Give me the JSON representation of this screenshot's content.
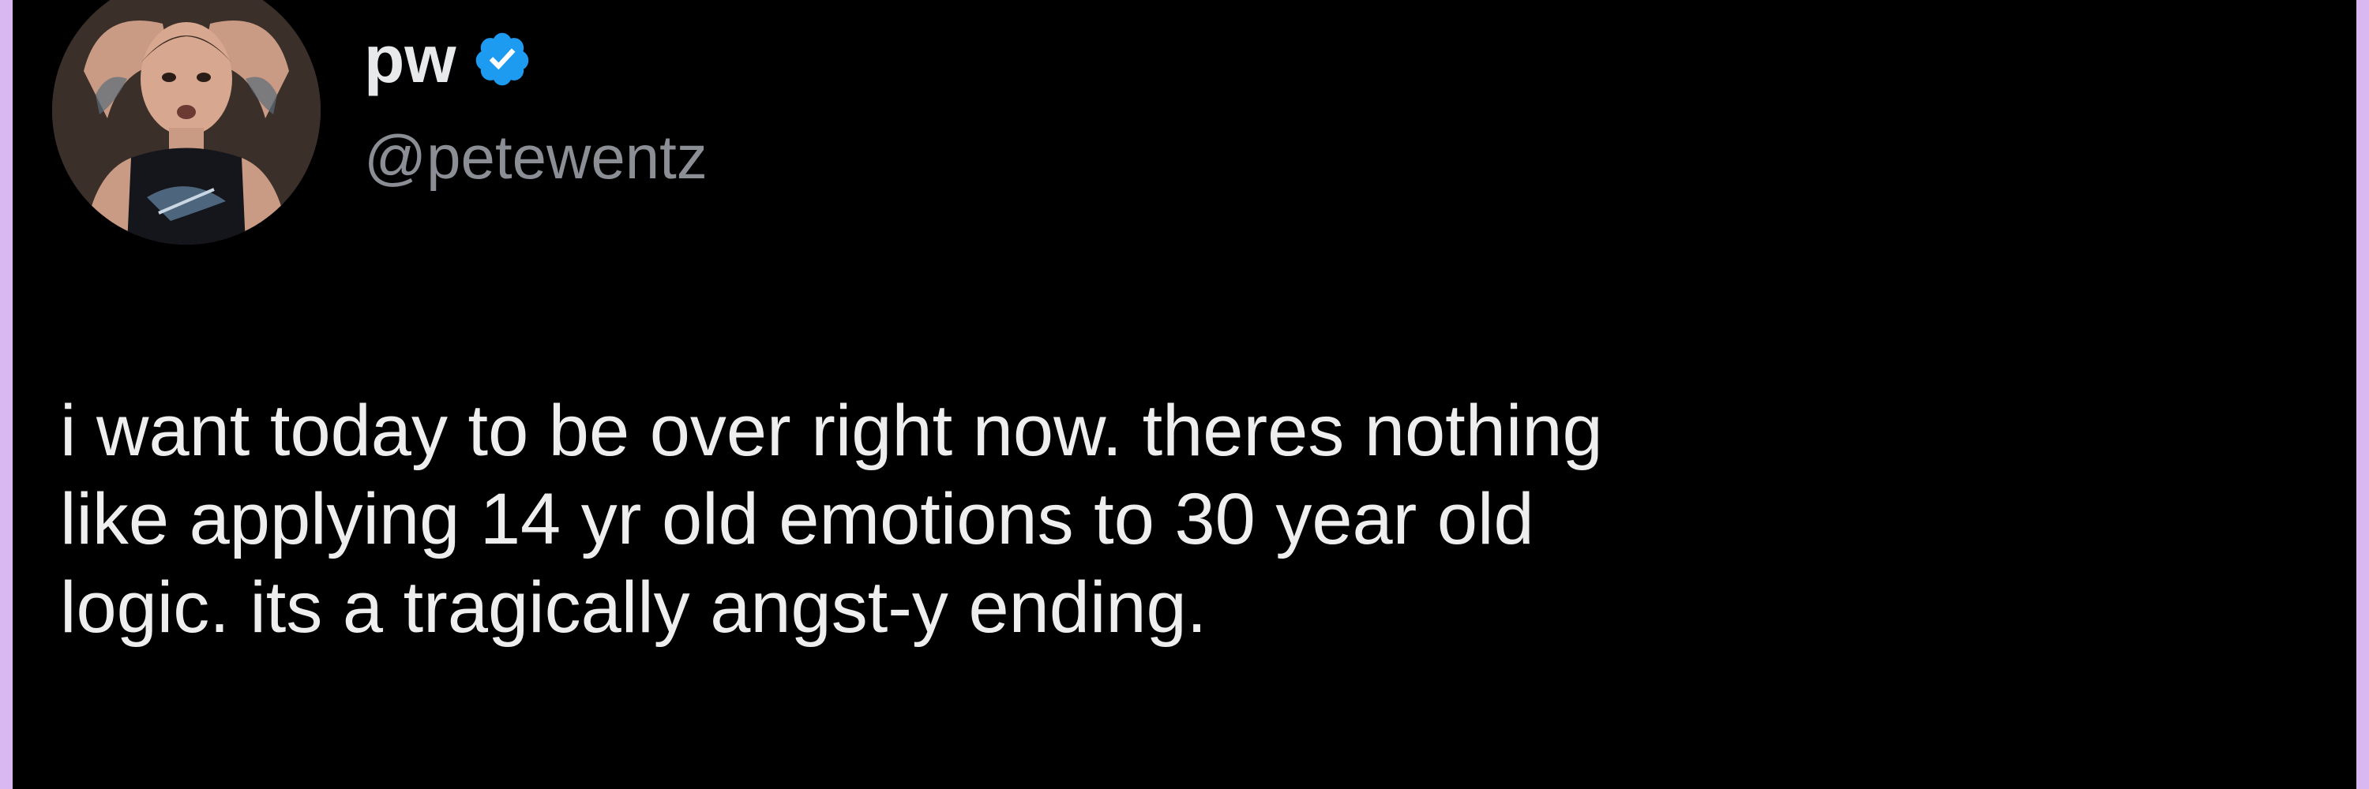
{
  "theme": {
    "background": "#000000",
    "frame_border": "#d9b8f2",
    "text_primary": "#e7e9ea",
    "text_secondary": "#8b8f95",
    "verified_color": "#1d9bf0"
  },
  "author": {
    "display_name": "pw",
    "handle": "@petewentz",
    "verified": true,
    "verified_icon": "verified-badge-icon",
    "avatar_icon": "profile-avatar"
  },
  "tweet": {
    "lines": [
      "i want today to be over right now. theres nothing",
      "like applying 14 yr old emotions to 30 year old",
      "logic. its a tragically angst-y ending."
    ]
  }
}
